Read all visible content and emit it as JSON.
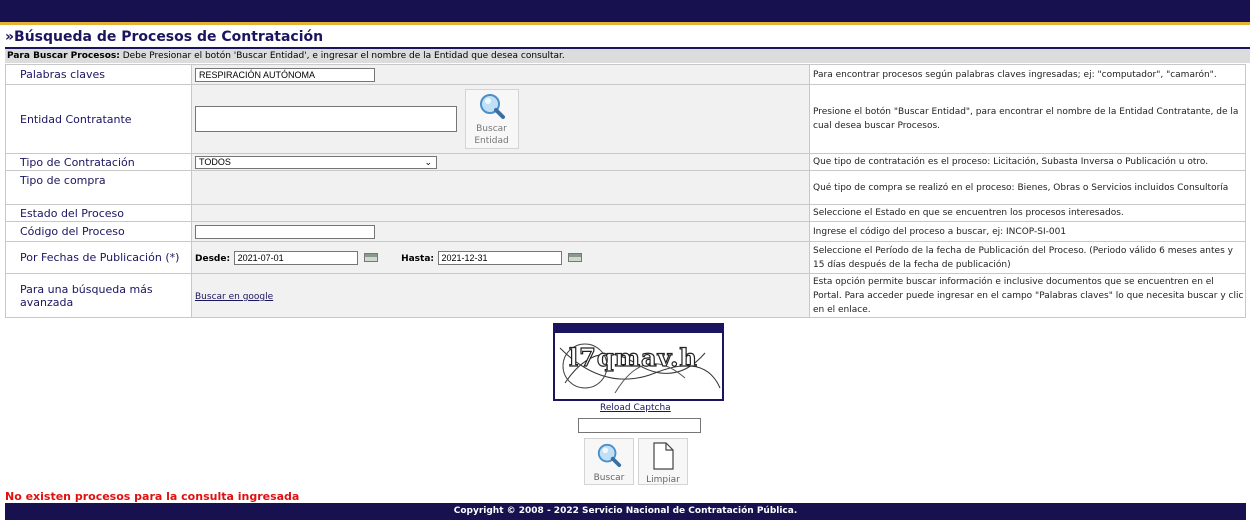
{
  "page": {
    "title": "»Búsqueda de Procesos de Contratación",
    "instructions_bold": "Para Buscar Procesos:",
    "instructions_text": " Debe Presionar el botón 'Buscar Entidad', e ingresar el nombre de la Entidad que desea consultar."
  },
  "form": {
    "keywords": {
      "label": "Palabras claves",
      "value": "RESPIRACIÓN AUTÓNOMA",
      "help": "Para encontrar procesos según palabras claves ingresadas; ej: \"computador\", \"camarón\"."
    },
    "entity": {
      "label": "Entidad Contratante",
      "value": "",
      "button_line1": "Buscar",
      "button_line2": "Entidad",
      "help": "Presione el botón \"Buscar Entidad\", para encontrar el nombre de la Entidad Contratante, de la cual desea buscar Procesos."
    },
    "contract_type": {
      "label": "Tipo de Contratación",
      "selected": "TODOS",
      "help": "Que tipo de contratación es el proceso: Licitación, Subasta Inversa o Publicación u otro."
    },
    "purchase_type": {
      "label": "Tipo de compra",
      "help": "Qué tipo de compra se realizó en el proceso: Bienes, Obras o Servicios incluidos Consultoría"
    },
    "status": {
      "label": "Estado del Proceso",
      "help": "Seleccione el Estado en que se encuentren los procesos interesados."
    },
    "code": {
      "label": "Código del Proceso",
      "value": "",
      "help": "Ingrese el código del proceso a buscar, ej: INCOP-SI-001"
    },
    "dates": {
      "label": "Por Fechas de Publicación (*)",
      "from_label": "Desde:",
      "from_value": "2021-07-01",
      "to_label": "Hasta:",
      "to_value": "2021-12-31",
      "help": "Seleccione el Período de la fecha de Publicación del Proceso. (Periodo válido 6 meses antes y 15 días después de la fecha de publicación)"
    },
    "advanced": {
      "label": "Para una búsqueda más avanzada",
      "link": "Buscar en google",
      "help": "Esta opción permite buscar información e inclusive documentos que se encuentren en el Portal. Para acceder puede ingresar en el campo \"Palabras claves\" lo que necesita buscar y clic en el enlace."
    }
  },
  "captcha": {
    "text": "l7qmav.h",
    "reload": "Reload Captcha",
    "value": ""
  },
  "buttons": {
    "search": "Buscar",
    "clear": "Limpiar"
  },
  "result_message": "No existen procesos para la consulta ingresada",
  "footer": "Copyright © 2008 - 2022 Servicio Nacional de Contratación Pública.",
  "colors": {
    "navy": "#17114f",
    "accent": "#e3b236",
    "error": "#e01010"
  }
}
